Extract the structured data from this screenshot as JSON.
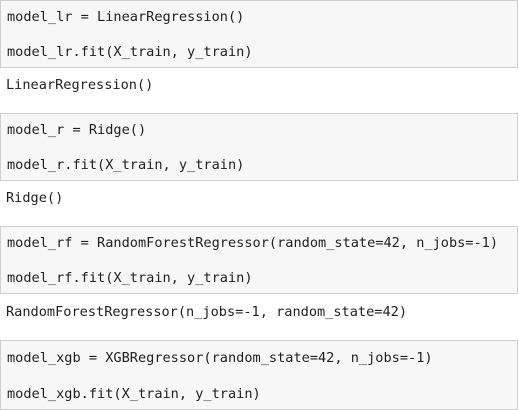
{
  "cells": [
    {
      "input_lines": [
        "model_lr = LinearRegression()",
        "model_lr.fit(X_train, y_train)"
      ],
      "output": "LinearRegression()"
    },
    {
      "input_lines": [
        "model_r = Ridge()",
        "model_r.fit(X_train, y_train)"
      ],
      "output": "Ridge()"
    },
    {
      "input_lines": [
        "model_rf = RandomForestRegressor(random_state=42, n_jobs=-1)",
        "model_rf.fit(X_train, y_train)"
      ],
      "output": "RandomForestRegressor(n_jobs=-1, random_state=42)"
    },
    {
      "input_lines": [
        "model_xgb = XGBRegressor(random_state=42, n_jobs=-1)",
        "model_xgb.fit(X_train, y_train)"
      ],
      "output": ""
    }
  ]
}
